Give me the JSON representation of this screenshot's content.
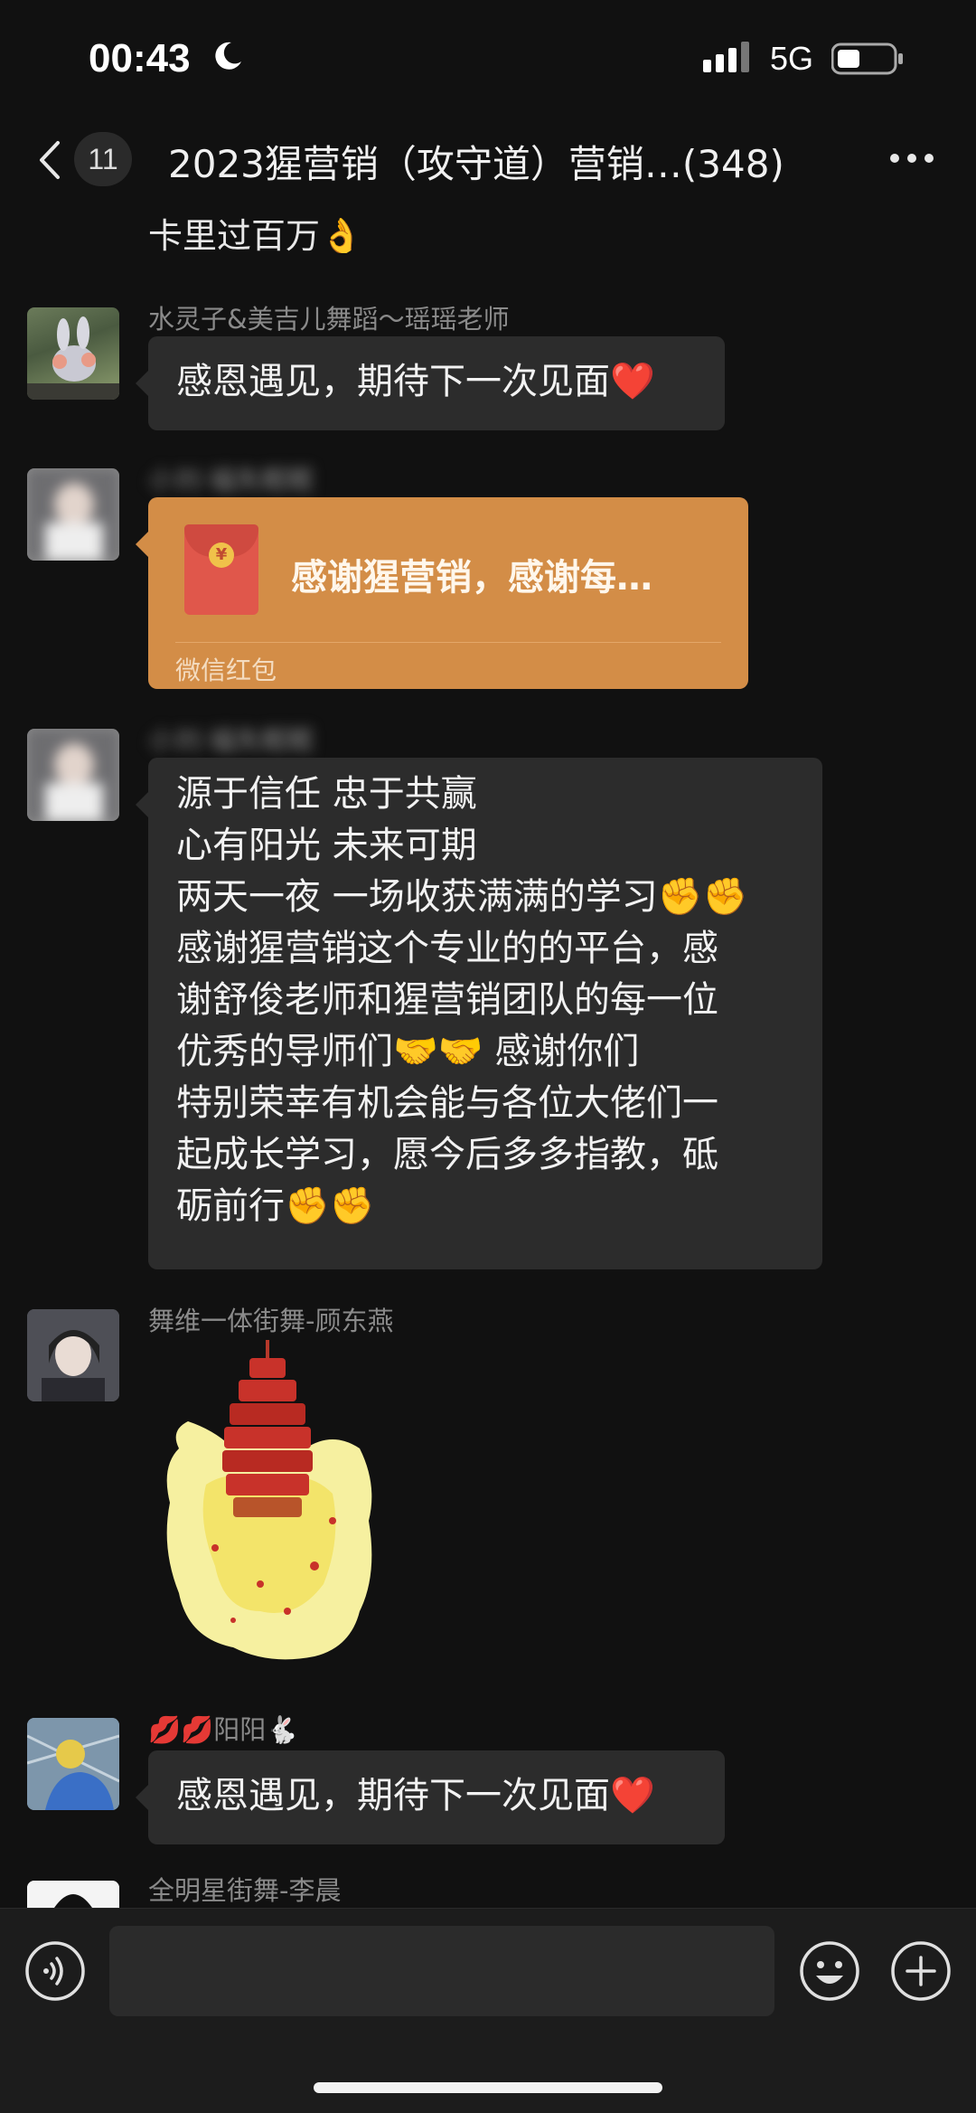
{
  "status_bar": {
    "time": "00:43",
    "network": "5G"
  },
  "header": {
    "unread_count": "11",
    "title": "2023猩营销（攻守道）营销…(348)"
  },
  "messages": [
    {
      "type": "partial",
      "text": "卡里过百万👌"
    },
    {
      "type": "text",
      "sender": "水灵子&美吉儿舞蹈～瑶瑶老师",
      "text": "感恩遇见，期待下一次见面❤️"
    },
    {
      "type": "red_packet",
      "sender": "小刘·福失眠眠",
      "text": "感谢猩营销，感谢每…",
      "footer": "微信红包"
    },
    {
      "type": "text",
      "sender": "小刘·福失眠眠",
      "lines": [
        "源于信任 忠于共赢",
        "心有阳光 未来可期",
        "两天一夜 一场收获满满的学习✊✊",
        "感谢猩营销这个专业的的平台，感",
        "谢舒俊老师和猩营销团队的每一位",
        "优秀的导师们🤝🤝 感谢你们",
        "特别荣幸有机会能与各位大佬们一",
        "起成长学习，愿今后多多指教，砥",
        "砺前行✊✊"
      ]
    },
    {
      "type": "sticker",
      "sender": "舞维一体街舞-顾东燕",
      "sticker": "firecracker-sticker"
    },
    {
      "type": "text",
      "sender": "💋💋阳阳🐇",
      "text": "感恩遇见，期待下一次见面❤️"
    },
    {
      "type": "partial_sender",
      "sender": "全明星街舞-李晨"
    }
  ],
  "icons": [
    "back-icon",
    "more-icon",
    "voice-icon",
    "emoji-icon",
    "plus-icon"
  ],
  "colors": {
    "background": "#111111",
    "bubble": "#2c2c2c",
    "red_packet": "#d38d47",
    "red_envelope": "#e0574b"
  }
}
